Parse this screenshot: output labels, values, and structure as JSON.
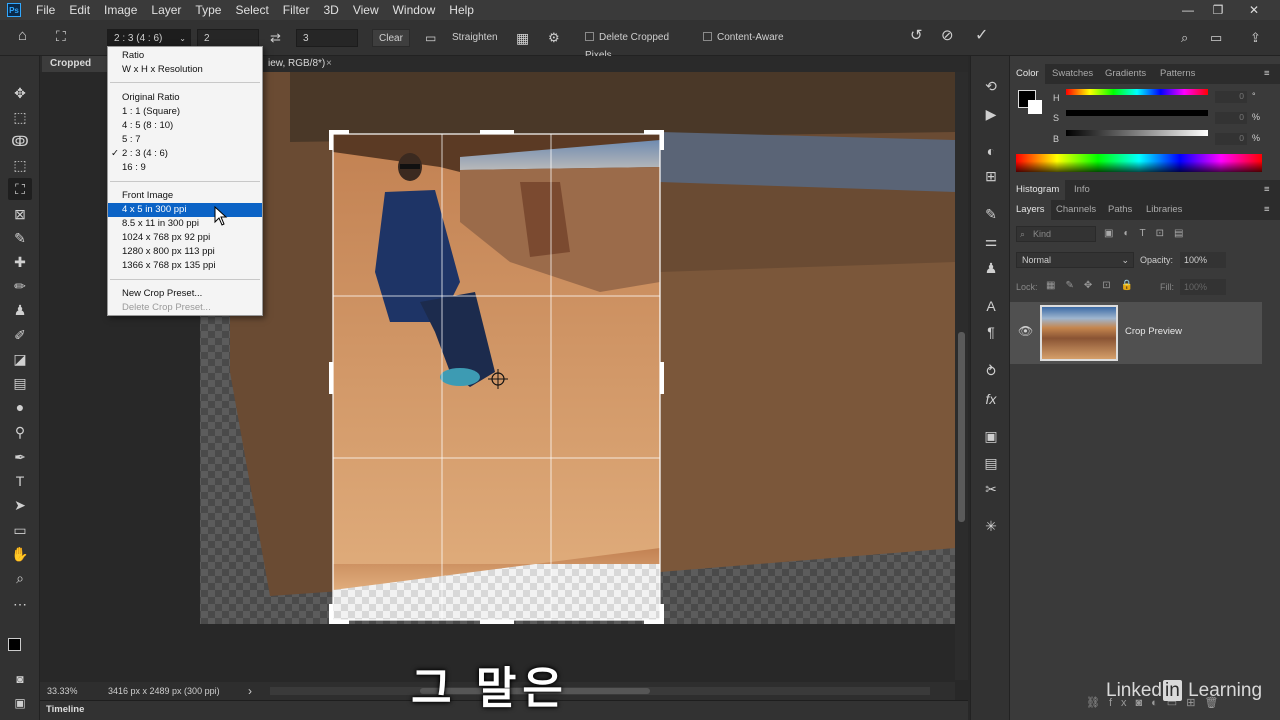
{
  "menubar": {
    "logo": "Ps",
    "items": [
      "File",
      "Edit",
      "Image",
      "Layer",
      "Type",
      "Select",
      "Filter",
      "3D",
      "View",
      "Window",
      "Help"
    ],
    "window_controls": [
      "—",
      "❐",
      "✕"
    ]
  },
  "options": {
    "ratio_select": "2 : 3 (4 : 6)",
    "width_value": "2",
    "height_value": "3",
    "clear_label": "Clear",
    "straighten_label": "Straighten",
    "delete_cropped_label": "Delete Cropped Pixels",
    "content_aware_label": "Content-Aware"
  },
  "dropdown": {
    "items": [
      {
        "label": "Ratio"
      },
      {
        "label": "W x H x Resolution"
      },
      {
        "label": "Original Ratio"
      },
      {
        "label": "1 : 1 (Square)"
      },
      {
        "label": "4 : 5 (8 : 10)"
      },
      {
        "label": "5 : 7"
      },
      {
        "label": "2 : 3 (4 : 6)",
        "checked": true
      },
      {
        "label": "16 : 9"
      },
      {
        "label": "Front Image"
      },
      {
        "label": "4 x 5 in 300 ppi",
        "highlighted": true
      },
      {
        "label": "8.5 x 11 in 300 ppi"
      },
      {
        "label": "1024 x 768 px 92 ppi"
      },
      {
        "label": "1280 x 800 px 113 ppi"
      },
      {
        "label": "1366 x 768 px 135 ppi"
      },
      {
        "label": "New Crop Preset..."
      },
      {
        "label": "Delete Crop Preset...",
        "disabled": true
      }
    ],
    "checkmark": "✓"
  },
  "tabs": {
    "doc1": "Cropped Me",
    "doc2_suffix": "iew, RGB/8*)",
    "close": "×"
  },
  "status": {
    "zoom": "33.33%",
    "dimensions": "3416 px x 2489 px (300 ppi)",
    "arrow": "›"
  },
  "timeline_label": "Timeline",
  "panels": {
    "color_tabs": [
      "Color",
      "Swatches",
      "Gradients",
      "Patterns"
    ],
    "color_slider_labels": [
      "H",
      "S",
      "B"
    ],
    "color_values": [
      "0",
      "0",
      "0"
    ],
    "color_units": [
      "°",
      "%",
      "%"
    ],
    "histogram_tabs": [
      "Histogram",
      "Info"
    ],
    "layers_tabs": [
      "Layers",
      "Channels",
      "Paths",
      "Libraries"
    ],
    "kind_placeholder": "Kind",
    "blend_mode": "Normal",
    "opacity_label": "Opacity:",
    "opacity_value": "100%",
    "lock_label": "Lock:",
    "fill_label": "Fill:",
    "fill_value": "100%",
    "layer_name": "Crop Preview"
  },
  "subtitle": "그 말은",
  "brand": {
    "part1": "Linked",
    "part2": "in",
    "part3": " Learning"
  },
  "colors": {
    "accent_selection": "#0b63c6",
    "crop_frame": "#ffffff",
    "canvas_rock": "#c9905c"
  }
}
